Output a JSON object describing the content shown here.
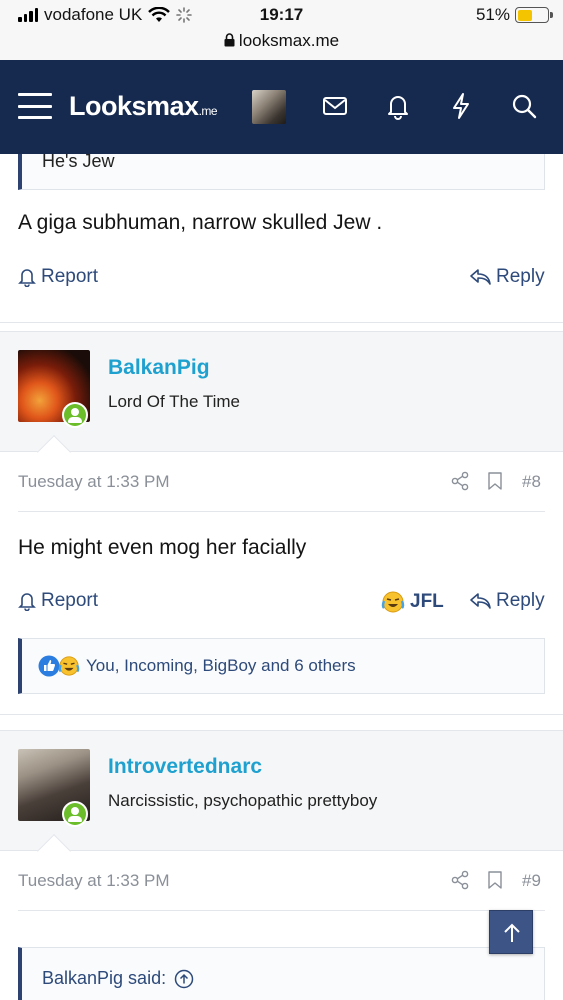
{
  "status_bar": {
    "carrier": "vodafone UK",
    "time": "19:17",
    "battery": "51%",
    "battery_level": 0.51,
    "url": "looksmax.me"
  },
  "header": {
    "logo_main": "Looksmax",
    "logo_suffix": ".me"
  },
  "post7": {
    "quote_text": "He's Jew",
    "body": "A giga subhuman, narrow skulled Jew .",
    "report_label": "Report",
    "reply_label": "Reply"
  },
  "post8": {
    "username": "BalkanPig",
    "user_title": "Lord Of The Time",
    "date": "Tuesday at 1:33 PM",
    "post_number": "#8",
    "body": "He might even mog her facially",
    "report_label": "Report",
    "reaction_label": "JFL",
    "reply_label": "Reply",
    "reactions_summary": "You, Incoming, BigBoy and 6 others"
  },
  "post9": {
    "username": "Introvertednarc",
    "user_title": "Narcissistic, psychopathic prettyboy",
    "date": "Tuesday at 1:33 PM",
    "post_number": "#9",
    "quote_author": "BalkanPig said:"
  },
  "colors": {
    "header_bg": "#16294f",
    "username": "#1fa1d0",
    "link": "#2d4a7a",
    "online": "#6bbd2a"
  }
}
